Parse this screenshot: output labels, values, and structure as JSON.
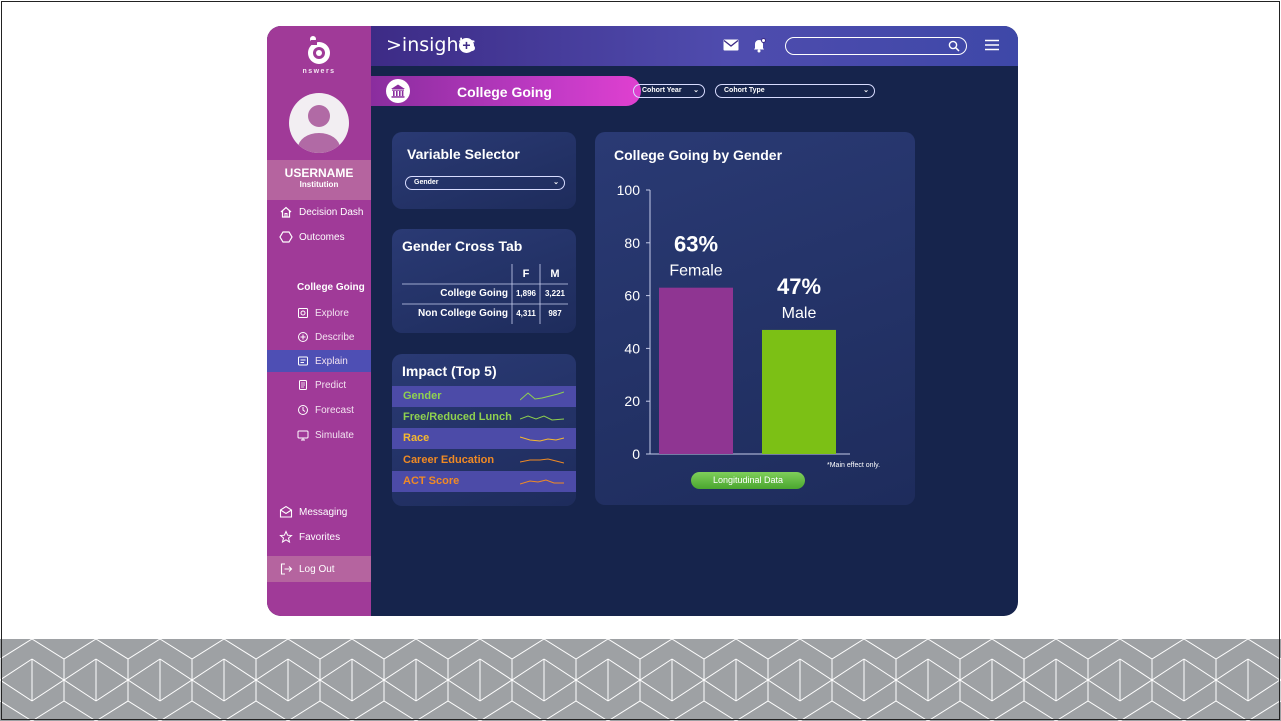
{
  "app": {
    "logo_text": "nswers",
    "brand": ">insights"
  },
  "sidebar": {
    "username": "USERNAME",
    "institution": "Institution",
    "items": [
      {
        "label": "Decision Dash",
        "icon": "home-icon"
      },
      {
        "label": "Outcomes",
        "icon": "hexagon-icon"
      }
    ],
    "section_heading": "College Going",
    "sub_items": [
      {
        "label": "Explore",
        "icon": "explore-icon"
      },
      {
        "label": "Describe",
        "icon": "describe-icon"
      },
      {
        "label": "Explain",
        "icon": "explain-icon",
        "active": true
      },
      {
        "label": "Predict",
        "icon": "predict-icon"
      },
      {
        "label": "Forecast",
        "icon": "forecast-icon"
      },
      {
        "label": "Simulate",
        "icon": "simulate-icon"
      }
    ],
    "bottom_items": [
      {
        "label": "Messaging",
        "icon": "messaging-icon"
      },
      {
        "label": "Favorites",
        "icon": "star-icon"
      }
    ],
    "logout_label": "Log Out"
  },
  "banner": {
    "title": "College Going",
    "cohort_year": "Cohort Year",
    "cohort_type": "Cohort Type"
  },
  "variable_selector": {
    "title": "Variable Selector",
    "selected": "Gender"
  },
  "crosstab": {
    "title": "Gender Cross Tab",
    "columns": [
      "F",
      "M"
    ],
    "rows": [
      {
        "label": "College Going",
        "values": [
          "1,896",
          "3,221"
        ]
      },
      {
        "label": "Non College Going",
        "values": [
          "4,311",
          "987"
        ]
      }
    ]
  },
  "impact": {
    "title": "Impact (Top 5)",
    "items": [
      {
        "label": "Gender",
        "color": "#8fd14f"
      },
      {
        "label": "Free/Reduced Lunch",
        "color": "#8fd14f"
      },
      {
        "label": "Race",
        "color": "#f5b82e"
      },
      {
        "label": "Career Education",
        "color": "#f08a24"
      },
      {
        "label": "ACT Score",
        "color": "#f08a24"
      }
    ]
  },
  "chart_panel": {
    "note": "*Main effect only.",
    "button_label": "Longitudinal Data"
  },
  "chart_data": {
    "type": "bar",
    "title": "College Going by Gender",
    "categories": [
      "Female",
      "Male"
    ],
    "values": [
      63,
      47
    ],
    "data_labels": [
      "63%",
      "47%"
    ],
    "colors": [
      "#8f3592",
      "#7cc015"
    ],
    "ylim": [
      0,
      100
    ],
    "yticks": [
      "0",
      "20",
      "40",
      "60",
      "80",
      "100"
    ],
    "xlabel": "",
    "ylabel": ""
  }
}
